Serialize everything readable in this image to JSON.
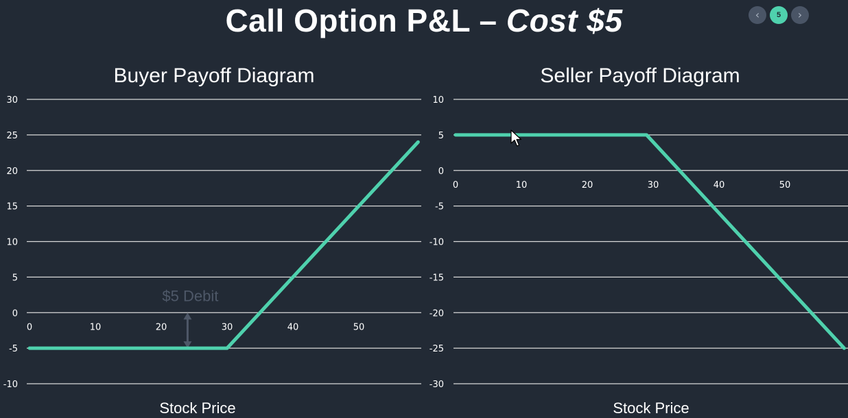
{
  "slide": {
    "title_main": "Call Option P&L – ",
    "title_emph": "Cost $5",
    "current_page": "5",
    "prev_icon": "chevron-left-icon",
    "next_icon": "chevron-right-icon"
  },
  "colors": {
    "background": "#222a35",
    "line": "#4fd1ad",
    "grid": "#d9d9d9",
    "annotation": "#4e5868"
  },
  "chart_data": [
    {
      "type": "line",
      "title": "Buyer Payoff Diagram",
      "xlabel": "Stock Price",
      "ylabel": "",
      "xlim": [
        0,
        60
      ],
      "ylim": [
        -10,
        30
      ],
      "xticks": [
        0,
        10,
        20,
        30,
        40,
        50
      ],
      "yticks": [
        -10,
        -5,
        0,
        5,
        10,
        15,
        20,
        25,
        30
      ],
      "grid": true,
      "series": [
        {
          "x": [
            0,
            30,
            59
          ],
          "y": [
            -5,
            -5,
            24
          ]
        }
      ],
      "annotations": [
        {
          "text": "$5 Debit",
          "x": 24,
          "y_from": 0,
          "y_to": -5
        }
      ]
    },
    {
      "type": "line",
      "title": "Seller Payoff Diagram",
      "xlabel": "Stock Price",
      "ylabel": "",
      "xlim": [
        0,
        60
      ],
      "ylim": [
        -30,
        10
      ],
      "xticks": [
        0,
        10,
        20,
        30,
        40,
        50
      ],
      "yticks": [
        -30,
        -25,
        -20,
        -15,
        -10,
        -5,
        0,
        5,
        10
      ],
      "grid": true,
      "series": [
        {
          "x": [
            0,
            29,
            59
          ],
          "y": [
            5,
            5,
            -25
          ]
        }
      ],
      "annotations": []
    }
  ]
}
